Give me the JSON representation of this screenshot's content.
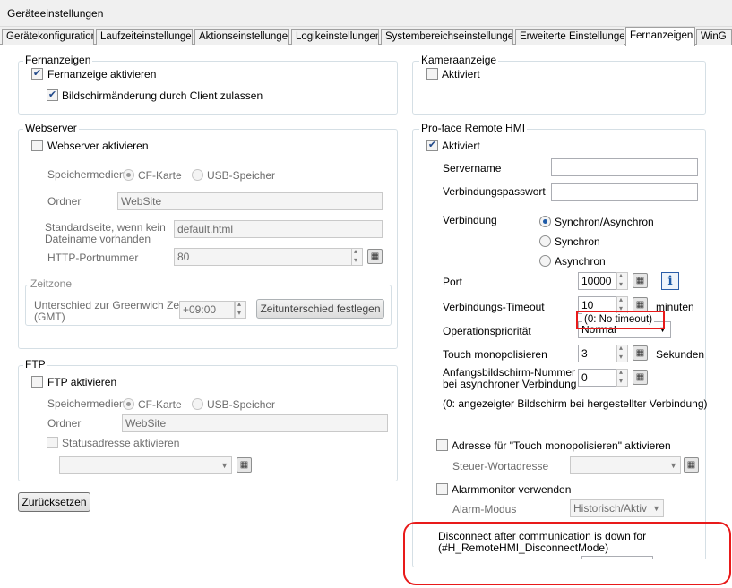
{
  "window": {
    "title": "Geräteeinstellungen"
  },
  "tabs": [
    "Gerätekonfiguration",
    "Laufzeiteinstellungen",
    "Aktionseinstellungen",
    "Logikeinstellungen",
    "Systembereichseinstellungen",
    "Erweiterte Einstellungen",
    "Fernanzeigen",
    "WinG"
  ],
  "fernanzeigen": {
    "title": "Fernanzeigen",
    "enable_label": "Fernanzeige aktivieren",
    "client_change_label": "Bildschirmänderung durch Client zulassen"
  },
  "kamera": {
    "title": "Kameraanzeige",
    "enable_label": "Aktiviert"
  },
  "webserver": {
    "title": "Webserver",
    "enable_label": "Webserver aktivieren",
    "storage_label": "Speichermedien",
    "cf_label": "CF-Karte",
    "usb_label": "USB-Speicher",
    "folder_label": "Ordner",
    "folder_value": "WebSite",
    "default_page_label_1": "Standardseite, wenn kein",
    "default_page_label_2": "Dateiname vorhanden",
    "default_page_value": "default.html",
    "port_label": "HTTP-Portnummer",
    "port_value": "80",
    "zone_title": "Zeitzone",
    "gmt_label_1": "Unterschied zur Greenwich Zeit",
    "gmt_label_2": "(GMT)",
    "gmt_value": "+09:00",
    "set_offset_button": "Zeitunterschied festlegen"
  },
  "ftp": {
    "title": "FTP",
    "enable_label": "FTP aktivieren",
    "storage_label": "Speichermedien",
    "cf_label": "CF-Karte",
    "usb_label": "USB-Speicher",
    "folder_label": "Ordner",
    "folder_value": "WebSite",
    "status_label": "Statusadresse aktivieren"
  },
  "reset_button": "Zurücksetzen",
  "remote_hmi": {
    "title": "Pro-face Remote HMI",
    "enable_label": "Aktiviert",
    "server_label": "Servername",
    "password_label": "Verbindungspasswort",
    "connection_label": "Verbindung",
    "conn_options": [
      "Synchron/Asynchron",
      "Synchron",
      "Asynchron"
    ],
    "port_label": "Port",
    "port_value": "10000",
    "info_icon_text": "i",
    "timeout_label": "Verbindungs-Timeout",
    "timeout_value": "10",
    "timeout_unit": "minuten",
    "timeout_hint": "(0: No timeout)",
    "priority_label": "Operationspriorität",
    "priority_value": "Normal",
    "touch_label": "Touch monopolisieren",
    "touch_value": "3",
    "touch_unit": "Sekunden",
    "start_label_1": "Anfangsbildschirm-Nummer",
    "start_label_2": "bei asynchroner Verbindung",
    "start_value": "0",
    "start_hint": "(0: angezeigter Bildschirm bei hergestellter Verbindung)",
    "touch_addr_label": "Adresse für \"Touch monopolisieren\" aktivieren",
    "control_word_label": "Steuer-Wortadresse",
    "alarm_label": "Alarmmonitor verwenden",
    "alarm_mode_label": "Alarm-Modus",
    "alarm_mode_value": "Historisch/Aktiv",
    "disconnect_label_1": "Disconnect after communication is down for",
    "disconnect_label_2": "(#H_RemoteHMI_DisconnectMode)"
  },
  "icons": {
    "keypad": "keypad-icon",
    "info": "info-icon",
    "dropdown": "chevron-down-icon"
  },
  "colors": {
    "highlight": "#e81a1a",
    "accent": "#1e5ba8"
  }
}
